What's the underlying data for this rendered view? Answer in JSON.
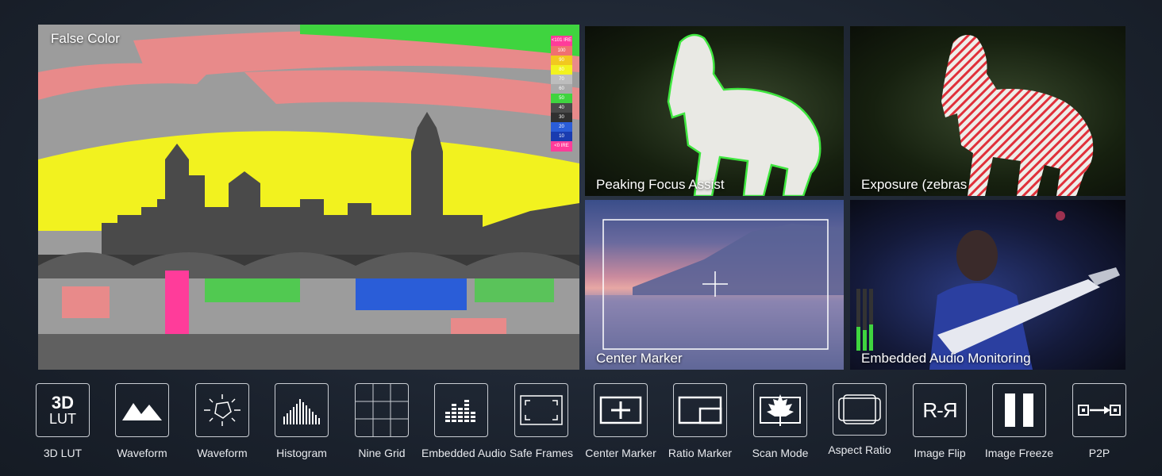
{
  "panels": {
    "false_color": {
      "label": "False Color"
    },
    "peaking": {
      "label": "Peaking Focus Assist"
    },
    "exposure": {
      "label": "Exposure (zebras"
    },
    "center_marker": {
      "label": "Center Marker"
    },
    "audio": {
      "label": "Embedded Audio Monitoring"
    }
  },
  "false_color_scale": [
    "<101 IRE",
    "100",
    "90",
    "80",
    "70",
    "60",
    "50",
    "40",
    "30",
    "20",
    "10",
    "<0 IRE"
  ],
  "icons": [
    {
      "label": "3D LUT",
      "glyph_top": "3D",
      "glyph_bottom": "LUT"
    },
    {
      "label": "Waveform"
    },
    {
      "label": "Waveform"
    },
    {
      "label": "Histogram"
    },
    {
      "label": "Nine Grid"
    },
    {
      "label": "Embedded Audio"
    },
    {
      "label": "Safe Frames"
    },
    {
      "label": "Center Marker"
    },
    {
      "label": "Ratio Marker"
    },
    {
      "label": "Scan Mode"
    },
    {
      "label": "Aspect Ratio"
    },
    {
      "label": "Image Flip",
      "glyph": "R-Я"
    },
    {
      "label": "Image Freeze"
    },
    {
      "label": "P2P"
    }
  ]
}
